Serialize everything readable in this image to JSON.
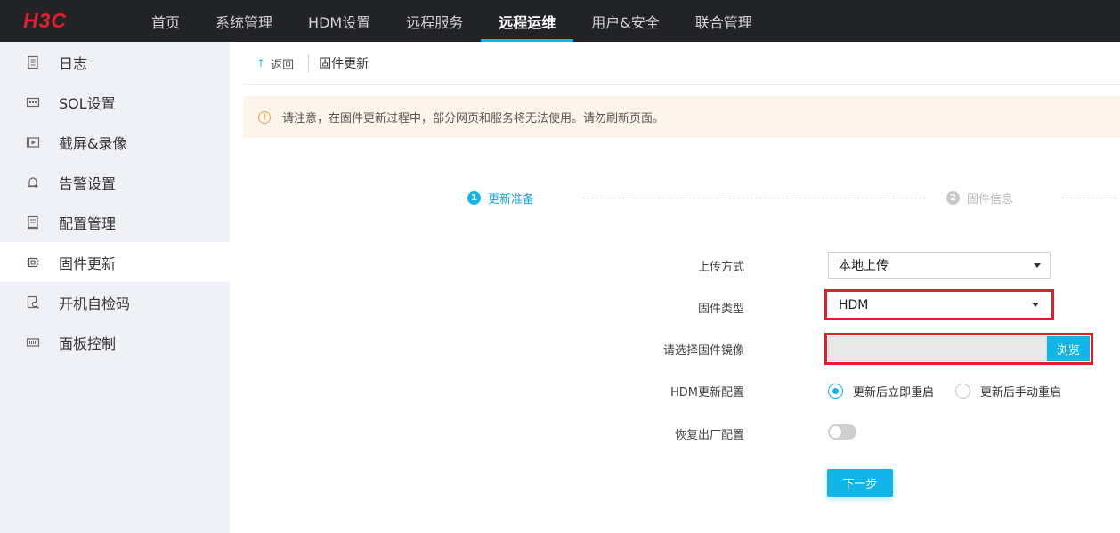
{
  "brand": {
    "logo_text": "H3C",
    "logo_color": "#e0202e"
  },
  "colors": {
    "accent": "#12b5e8",
    "highlight": "#e01e2a",
    "topbar": "#222327",
    "sidebar": "#f0f1f6"
  },
  "nav": {
    "items": [
      {
        "label": "首页"
      },
      {
        "label": "系统管理"
      },
      {
        "label": "HDM设置"
      },
      {
        "label": "远程服务"
      },
      {
        "label": "远程运维",
        "active": true
      },
      {
        "label": "用户&安全"
      },
      {
        "label": "联合管理"
      }
    ]
  },
  "sidebar": {
    "items": [
      {
        "label": "日志",
        "icon": "log-icon"
      },
      {
        "label": "SOL设置",
        "icon": "sol-icon"
      },
      {
        "label": "截屏&录像",
        "icon": "video-icon"
      },
      {
        "label": "告警设置",
        "icon": "alarm-icon"
      },
      {
        "label": "配置管理",
        "icon": "config-icon"
      },
      {
        "label": "固件更新",
        "icon": "chip-icon",
        "active": true
      },
      {
        "label": "开机自检码",
        "icon": "post-code-icon"
      },
      {
        "label": "面板控制",
        "icon": "panel-icon"
      }
    ]
  },
  "breadcrumb": {
    "back_label": "返回",
    "title": "固件更新"
  },
  "notice": {
    "text": "请注意，在固件更新过程中，部分网页和服务将无法使用。请勿刷新页面。"
  },
  "steps": [
    {
      "num": "1",
      "label": "更新准备",
      "active": true
    },
    {
      "num": "2",
      "label": "固件信息",
      "active": false
    }
  ],
  "form": {
    "upload_method": {
      "label": "上传方式",
      "value": "本地上传"
    },
    "firmware_type": {
      "label": "固件类型",
      "value": "HDM"
    },
    "firmware_image": {
      "label": "请选择固件镜像",
      "value": "",
      "browse_label": "浏览"
    },
    "hdm_update_config": {
      "label": "HDM更新配置",
      "options": [
        {
          "label": "更新后立即重启",
          "checked": true
        },
        {
          "label": "更新后手动重启",
          "checked": false
        }
      ]
    },
    "restore_factory": {
      "label": "恢复出厂配置",
      "enabled": false
    },
    "next_label": "下一步"
  }
}
